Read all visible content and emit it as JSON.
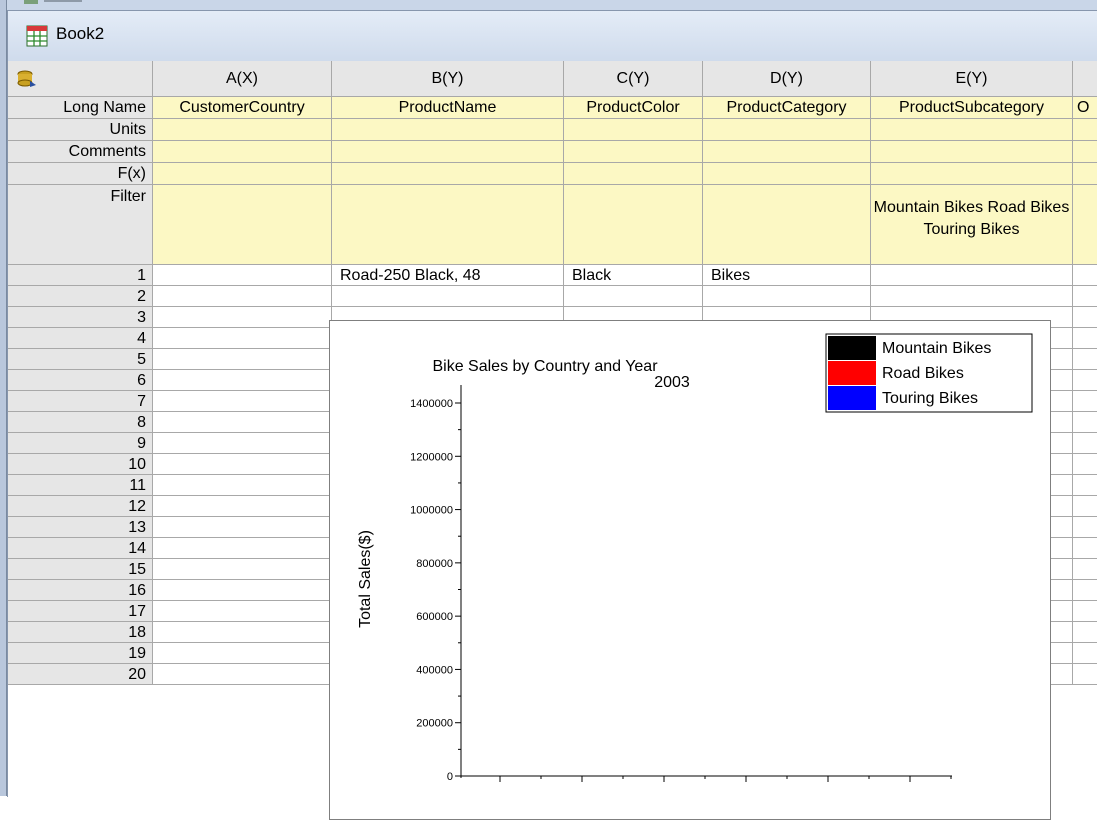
{
  "window": {
    "title": "Book2"
  },
  "columns": [
    {
      "header": "A(X)",
      "long_name": "CustomerCountry"
    },
    {
      "header": "B(Y)",
      "long_name": "ProductName"
    },
    {
      "header": "C(Y)",
      "long_name": "ProductColor"
    },
    {
      "header": "D(Y)",
      "long_name": "ProductCategory"
    },
    {
      "header": "E(Y)",
      "long_name": "ProductSubcategory",
      "filter": "Mountain Bikes Road Bikes Touring Bikes"
    },
    {
      "header": "",
      "long_name": "O"
    }
  ],
  "meta_rows": [
    "Long Name",
    "Units",
    "Comments",
    "F(x)",
    "Filter"
  ],
  "rows": [
    {
      "num": "1",
      "cells": [
        "",
        "Road-250 Black, 48",
        "Black",
        "Bikes",
        "",
        ""
      ]
    },
    {
      "num": "2"
    },
    {
      "num": "3"
    },
    {
      "num": "4"
    },
    {
      "num": "5"
    },
    {
      "num": "6"
    },
    {
      "num": "7"
    },
    {
      "num": "8"
    },
    {
      "num": "9"
    },
    {
      "num": "10"
    },
    {
      "num": "11"
    },
    {
      "num": "12"
    },
    {
      "num": "13"
    },
    {
      "num": "14"
    },
    {
      "num": "15"
    },
    {
      "num": "16"
    },
    {
      "num": "17"
    },
    {
      "num": "18"
    },
    {
      "num": "19"
    },
    {
      "num": "20"
    }
  ],
  "chart_data": {
    "type": "bar",
    "title": "Bike Sales by Country and Year",
    "subtitle": "2003",
    "ylabel": "Total Sales($)",
    "xlabel": "",
    "ylim": [
      0,
      1400000
    ],
    "yticks": [
      "0",
      "200000",
      "400000",
      "600000",
      "800000",
      "1000000",
      "1200000",
      "1400000"
    ],
    "legend_position": "top-right",
    "series": [
      {
        "name": "Mountain Bikes",
        "color": "#000000",
        "values": []
      },
      {
        "name": "Road Bikes",
        "color": "#ff0000",
        "values": []
      },
      {
        "name": "Touring Bikes",
        "color": "#0000ff",
        "values": []
      }
    ]
  }
}
